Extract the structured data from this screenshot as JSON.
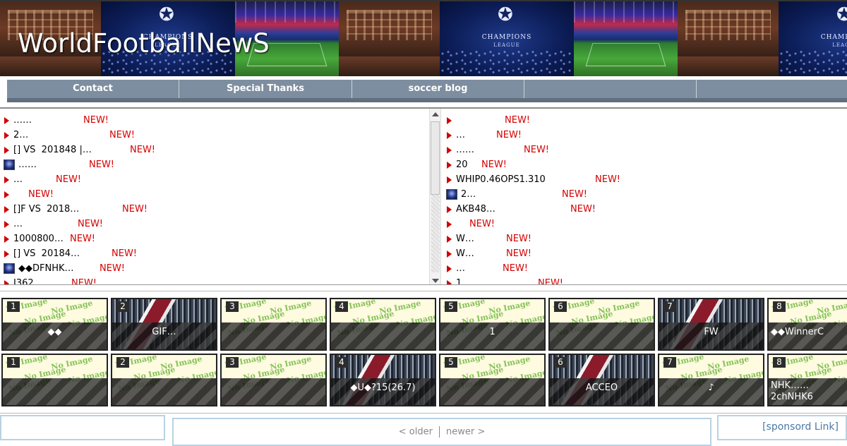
{
  "header": {
    "site_title": "WorldFootballNewS",
    "banner_labels": {
      "ucl": "CHAMPIONS",
      "league": "LEAGUE"
    }
  },
  "nav": {
    "items": [
      "Contact",
      "Special Thanks",
      "soccer blog",
      "",
      ""
    ]
  },
  "lists": {
    "new_label": "NEW!",
    "left": [
      {
        "icon": "triangle-icon",
        "text": "……"
      },
      {
        "icon": "triangle-icon",
        "text": "2…"
      },
      {
        "icon": "triangle-icon",
        "text": "[] VS  201848 |…"
      },
      {
        "icon": "ucl-badge-icon",
        "text": "……"
      },
      {
        "icon": "triangle-icon",
        "text": "…"
      },
      {
        "icon": "triangle-icon",
        "text": ""
      },
      {
        "icon": "triangle-icon",
        "text": "[]F VS  2018…"
      },
      {
        "icon": "triangle-icon",
        "text": "…"
      },
      {
        "icon": "triangle-icon",
        "text": "1000800…"
      },
      {
        "icon": "triangle-icon",
        "text": "[] VS  20184…"
      },
      {
        "icon": "ucl-badge-icon",
        "text": "◆◆DFNHK…"
      },
      {
        "icon": "triangle-icon",
        "text": "J362"
      }
    ],
    "right": [
      {
        "icon": "triangle-icon",
        "text": ""
      },
      {
        "icon": "triangle-icon",
        "text": "…"
      },
      {
        "icon": "triangle-icon",
        "text": "……"
      },
      {
        "icon": "triangle-icon",
        "text": "20"
      },
      {
        "icon": "triangle-icon",
        "text": "WHIP0.46OPS1.310"
      },
      {
        "icon": "ucl-badge-icon",
        "text": "2…"
      },
      {
        "icon": "triangle-icon",
        "text": "AKB48…"
      },
      {
        "icon": "triangle-icon",
        "text": ""
      },
      {
        "icon": "triangle-icon",
        "text": "W…"
      },
      {
        "icon": "triangle-icon",
        "text": "W…"
      },
      {
        "icon": "triangle-icon",
        "text": "…"
      },
      {
        "icon": "triangle-icon",
        "text": "1"
      }
    ]
  },
  "thumbs": {
    "no_image_text": "No Image",
    "row1": [
      {
        "num": "1",
        "image": "no-image",
        "caption": "◆◆"
      },
      {
        "num": "2",
        "image": "crowd",
        "caption": "GIF…"
      },
      {
        "num": "3",
        "image": "no-image",
        "caption": ""
      },
      {
        "num": "4",
        "image": "no-image",
        "caption": ""
      },
      {
        "num": "5",
        "image": "no-image",
        "caption": "1"
      },
      {
        "num": "6",
        "image": "no-image",
        "caption": ""
      },
      {
        "num": "7",
        "image": "crowd",
        "caption": "FW"
      },
      {
        "num": "8",
        "image": "no-image",
        "caption": "◆◆WinnerC"
      }
    ],
    "row2": [
      {
        "num": "1",
        "image": "no-image",
        "caption": ""
      },
      {
        "num": "2",
        "image": "no-image",
        "caption": ""
      },
      {
        "num": "3",
        "image": "no-image",
        "caption": ""
      },
      {
        "num": "4",
        "image": "crowd",
        "caption": "◆U◆?15(26.7)"
      },
      {
        "num": "5",
        "image": "no-image",
        "caption": ""
      },
      {
        "num": "6",
        "image": "crowd",
        "caption": "ACCEO"
      },
      {
        "num": "7",
        "image": "no-image",
        "caption": "♪"
      },
      {
        "num": "8",
        "image": "no-image",
        "caption": "NHK……\n2chNHK6"
      }
    ]
  },
  "footer": {
    "older": "< older",
    "newer": "newer >",
    "sponsor": "[sponsord Link]"
  },
  "colors": {
    "accent_red": "#d40000",
    "nav_bg": "#7d8ea0",
    "link_blue": "#4a79a5"
  }
}
